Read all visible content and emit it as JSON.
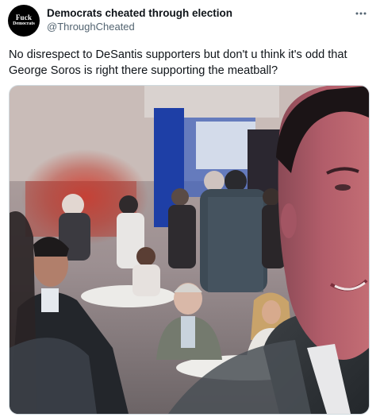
{
  "tweet": {
    "avatar": {
      "line1": "Fuck",
      "line2": "Democrats"
    },
    "display_name": "Democrats cheated through election",
    "handle": "@ThroughCheated",
    "more_icon": "more-horizontal-icon",
    "text": "No disrespect to DeSantis supporters but don't u think it's odd that George Soros is right there supporting the meatball?"
  },
  "colors": {
    "text_primary": "#0f1419",
    "text_secondary": "#536471",
    "border": "#cfd9de"
  }
}
